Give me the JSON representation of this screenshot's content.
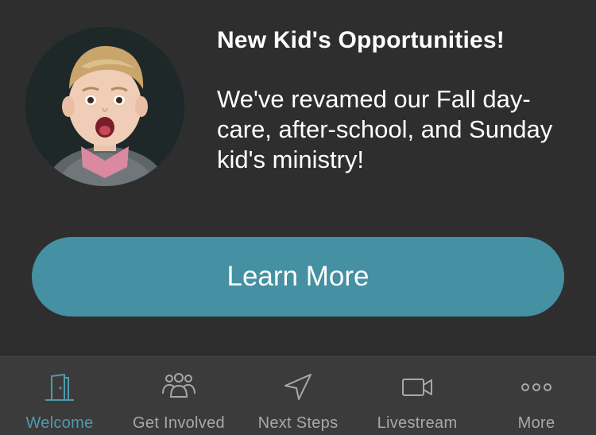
{
  "promo": {
    "title": "New Kid's Opportunities!",
    "body": "We've revamed our Fall day-care, after-school, and Sunday kid's ministry!",
    "button_label": "Learn More",
    "accent_color": "#4590a3"
  },
  "tabbar": {
    "active_color": "#4f9aab",
    "items": [
      {
        "label": "Welcome",
        "icon": "door-icon",
        "active": true
      },
      {
        "label": "Get Involved",
        "icon": "group-icon",
        "active": false
      },
      {
        "label": "Next Steps",
        "icon": "navigation-arrow-icon",
        "active": false
      },
      {
        "label": "Livestream",
        "icon": "video-camera-icon",
        "active": false
      },
      {
        "label": "More",
        "icon": "more-dots-icon",
        "active": false
      }
    ]
  }
}
